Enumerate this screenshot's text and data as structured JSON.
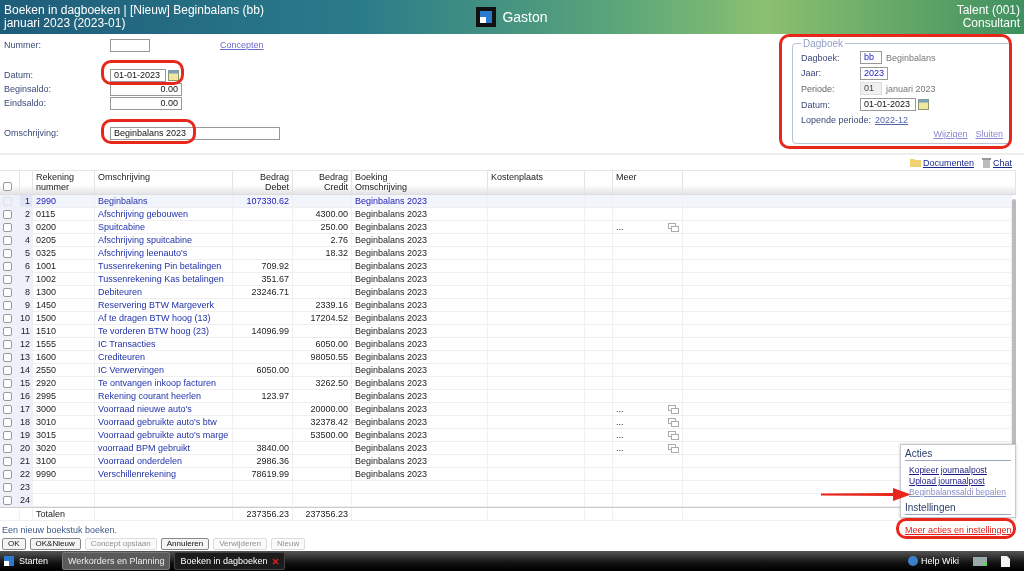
{
  "header": {
    "title": "Boeken in dagboeken | [Nieuw] Beginbalans (bb)",
    "subtitle": "januari 2023 (2023-01)",
    "app_name": "Gaston",
    "company": "Talent (001)",
    "role": "Consultant"
  },
  "form": {
    "nummer": {
      "label": "Nummer:"
    },
    "concepten_link": "Concepten",
    "datum": {
      "label": "Datum:",
      "value": "01-01-2023"
    },
    "beginsaldo": {
      "label": "Beginsaldo:",
      "value": "0.00"
    },
    "eindsaldo": {
      "label": "Eindsaldo:",
      "value": "0.00"
    },
    "omschrijving": {
      "label": "Omschrijving:",
      "value": "Beginbalans 2023"
    }
  },
  "dagboek_panel": {
    "legend": "Dagboek",
    "fields": [
      {
        "label": "Dagboek:",
        "value": "bb",
        "name": "Beginbalans",
        "kind": "input",
        "disabled": false
      },
      {
        "label": "Jaar:",
        "value": "2023",
        "kind": "input",
        "disabled": false
      },
      {
        "label": "Periode:",
        "value": "01",
        "name": "januari 2023",
        "kind": "input",
        "disabled": true
      },
      {
        "label": "Datum:",
        "value": "01-01-2023",
        "kind": "date",
        "disabled": false
      },
      {
        "label": "Lopende periode:",
        "value": "2022-12",
        "kind": "link",
        "disabled": false
      }
    ],
    "actions": [
      "Wijzigen",
      "Sluiten"
    ]
  },
  "toolbar": [
    {
      "label": "Documenten",
      "kind": "folder"
    },
    {
      "label": "Chat",
      "kind": "chat"
    }
  ],
  "table": {
    "header_checked": false,
    "columns": [
      {
        "lines": [
          "Rekening",
          "nummer"
        ],
        "kind": "text"
      },
      {
        "lines": [
          "Omschrijving"
        ],
        "kind": "text"
      },
      {
        "lines": [
          "Bedrag",
          "Debet"
        ],
        "kind": "amount"
      },
      {
        "lines": [
          "Bedrag",
          "Credit"
        ],
        "kind": "amount"
      },
      {
        "lines": [
          "Boeking",
          "Omschrijving"
        ],
        "kind": "text"
      },
      {
        "lines": [
          "Kostenplaats"
        ],
        "kind": "text"
      },
      {
        "kind": "text"
      },
      {
        "lines": [
          "Meer"
        ],
        "kind": "text"
      }
    ],
    "rows": [
      {
        "nr": "1",
        "rekening": "2990",
        "omschrijving": "Beginbalans",
        "debet": "107330.62",
        "boeking": "Beginbalans 2023",
        "checked": false,
        "selected": true
      },
      {
        "nr": "2",
        "rekening": "0115",
        "omschrijving": "Afschrijving gebouwen",
        "credit": "4300.00",
        "boeking": "Beginbalans 2023",
        "checked": false,
        "selected": false
      },
      {
        "nr": "3",
        "rekening": "0200",
        "omschrijving": "Spuitcabine",
        "credit": "250.00",
        "boeking": "Beginbalans 2023",
        "meer": "...",
        "checked": false,
        "selected": false
      },
      {
        "nr": "4",
        "rekening": "0205",
        "omschrijving": "Afschrijving spuitcabine",
        "credit": "2.76",
        "boeking": "Beginbalans 2023",
        "checked": false,
        "selected": false
      },
      {
        "nr": "5",
        "rekening": "0325",
        "omschrijving": "Afschrijving leenauto's",
        "credit": "18.32",
        "boeking": "Beginbalans 2023",
        "checked": false,
        "selected": false
      },
      {
        "nr": "6",
        "rekening": "1001",
        "omschrijving": "Tussenrekening Pin betalingen",
        "debet": "709.92",
        "boeking": "Beginbalans 2023",
        "checked": false,
        "selected": false
      },
      {
        "nr": "7",
        "rekening": "1002",
        "omschrijving": "Tussenrekening Kas betalingen",
        "debet": "351.67",
        "boeking": "Beginbalans 2023",
        "checked": false,
        "selected": false
      },
      {
        "nr": "8",
        "rekening": "1300",
        "omschrijving": "Debiteuren",
        "debet": "23246.71",
        "boeking": "Beginbalans 2023",
        "checked": false,
        "selected": false
      },
      {
        "nr": "9",
        "rekening": "1450",
        "omschrijving": "Reservering BTW Margeverk",
        "credit": "2339.16",
        "boeking": "Beginbalans 2023",
        "checked": false,
        "selected": false
      },
      {
        "nr": "10",
        "rekening": "1500",
        "omschrijving": "Af te dragen BTW hoog (13)",
        "credit": "17204.52",
        "boeking": "Beginbalans 2023",
        "checked": false,
        "selected": false
      },
      {
        "nr": "11",
        "rekening": "1510",
        "omschrijving": "Te vorderen BTW hoog (23)",
        "debet": "14096.99",
        "boeking": "Beginbalans 2023",
        "checked": false,
        "selected": false
      },
      {
        "nr": "12",
        "rekening": "1555",
        "omschrijving": "IC Transacties",
        "credit": "6050.00",
        "boeking": "Beginbalans 2023",
        "checked": false,
        "selected": false
      },
      {
        "nr": "13",
        "rekening": "1600",
        "omschrijving": "Crediteuren",
        "credit": "98050.55",
        "boeking": "Beginbalans 2023",
        "checked": false,
        "selected": false
      },
      {
        "nr": "14",
        "rekening": "2550",
        "omschrijving": "IC Verwervingen",
        "debet": "6050.00",
        "boeking": "Beginbalans 2023",
        "checked": false,
        "selected": false
      },
      {
        "nr": "15",
        "rekening": "2920",
        "omschrijving": "Te ontvangen inkoop facturen",
        "credit": "3262.50",
        "boeking": "Beginbalans 2023",
        "checked": false,
        "selected": false
      },
      {
        "nr": "16",
        "rekening": "2995",
        "omschrijving": "Rekening courant heerlen",
        "debet": "123.97",
        "boeking": "Beginbalans 2023",
        "checked": false,
        "selected": false
      },
      {
        "nr": "17",
        "rekening": "3000",
        "omschrijving": "Voorraad nieuwe auto's",
        "credit": "20000.00",
        "boeking": "Beginbalans 2023",
        "meer": "...",
        "checked": false,
        "selected": false
      },
      {
        "nr": "18",
        "rekening": "3010",
        "omschrijving": "Voorraad gebruikte auto's btw",
        "credit": "32378.42",
        "boeking": "Beginbalans 2023",
        "meer": "...",
        "checked": false,
        "selected": false
      },
      {
        "nr": "19",
        "rekening": "3015",
        "omschrijving": "Voorraad gebruikte auto's marge",
        "credit": "53500.00",
        "boeking": "Beginbalans 2023",
        "meer": "...",
        "checked": false,
        "selected": false
      },
      {
        "nr": "20",
        "rekening": "3020",
        "omschrijving": "voorraad BPM gebruikt",
        "debet": "3840.00",
        "boeking": "Beginbalans 2023",
        "meer": "...",
        "checked": false,
        "selected": false
      },
      {
        "nr": "21",
        "rekening": "3100",
        "omschrijving": "Voorraad onderdelen",
        "debet": "2986.36",
        "boeking": "Beginbalans 2023",
        "checked": false,
        "selected": false
      },
      {
        "nr": "22",
        "rekening": "9990",
        "omschrijving": "Verschillenrekening",
        "debet": "78619.99",
        "boeking": "Beginbalans 2023",
        "checked": false,
        "selected": false
      },
      {
        "nr": "23",
        "checked": false,
        "selected": false
      },
      {
        "nr": "24",
        "checked": false,
        "selected": false
      }
    ],
    "totals": {
      "label": "Totalen",
      "debet": "237356.23",
      "credit": "237356.23"
    }
  },
  "status_message": "Een nieuw boekstuk boeken.",
  "buttons": [
    {
      "label": "OK",
      "disabled": false
    },
    {
      "label": "OK&Nieuw",
      "disabled": false
    },
    {
      "label": "Concept opslaan",
      "disabled": true
    },
    {
      "label": "Annuleren",
      "disabled": false
    },
    {
      "label": "Verwijderen",
      "disabled": true
    },
    {
      "label": "Nieuw",
      "disabled": true
    }
  ],
  "actions_menu": {
    "sections": [
      {
        "title": "Acties",
        "items": [
          {
            "label": "Kopieer journaalpost",
            "disabled": false
          },
          {
            "label": "Upload journaalpost",
            "disabled": false
          },
          {
            "label": "Beginbalanssaldi bepalen",
            "disabled": true
          }
        ]
      },
      {
        "title": "Instellingen"
      }
    ]
  },
  "more_link": "Meer acties en instellingen.",
  "taskbar": {
    "start": "Starten",
    "tabs": [
      {
        "label": "Werkorders en Planning",
        "selected": false
      },
      {
        "label": "Boeken in dagboeken",
        "selected": true
      }
    ],
    "help": "Help Wiki"
  }
}
